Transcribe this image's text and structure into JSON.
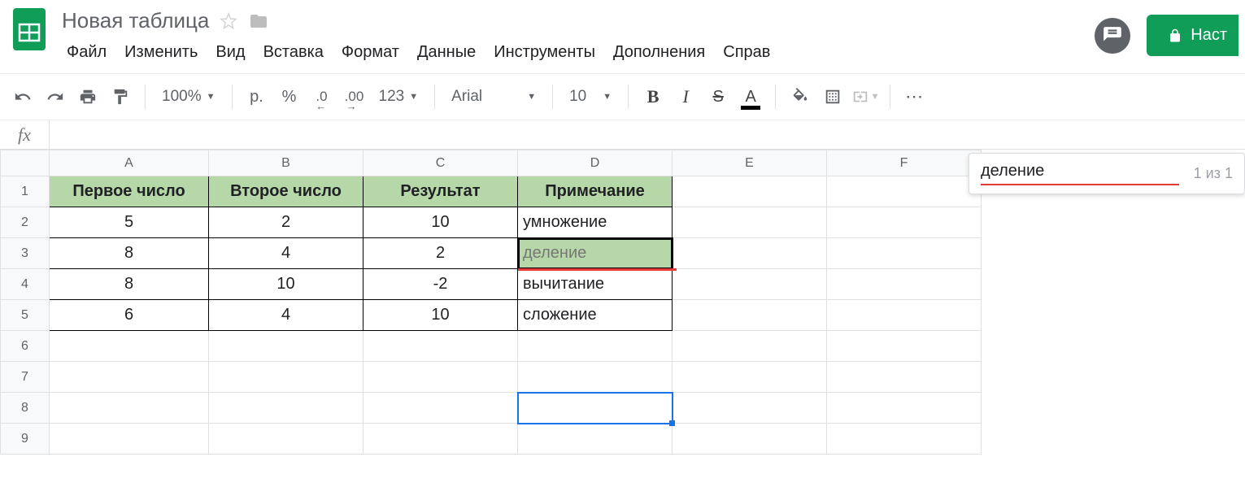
{
  "header": {
    "title": "Новая таблица",
    "menus": [
      "Файл",
      "Изменить",
      "Вид",
      "Вставка",
      "Формат",
      "Данные",
      "Инструменты",
      "Дополнения",
      "Справ"
    ],
    "share_label": "Наст"
  },
  "toolbar": {
    "zoom": "100%",
    "currency": "р.",
    "percent": "%",
    "dec_less": ".0",
    "dec_more": ".00",
    "format_more": "123",
    "font_name": "Arial",
    "font_size": "10",
    "bold": "B",
    "italic": "I",
    "strike": "S",
    "text_color": "A"
  },
  "formula_bar": {
    "fx": "fx",
    "value": ""
  },
  "grid": {
    "columns": [
      "A",
      "B",
      "C",
      "D",
      "E",
      "F"
    ],
    "row_numbers": [
      "1",
      "2",
      "3",
      "4",
      "5",
      "6",
      "7",
      "8",
      "9"
    ],
    "headers": [
      "Первое число",
      "Второе число",
      "Результат",
      "Примечание"
    ],
    "rows": [
      {
        "a": "5",
        "b": "2",
        "c": "10",
        "d": "умножение"
      },
      {
        "a": "8",
        "b": "4",
        "c": "2",
        "d": "деление"
      },
      {
        "a": "8",
        "b": "10",
        "c": "-2",
        "d": "вычитание"
      },
      {
        "a": "6",
        "b": "4",
        "c": "10",
        "d": "сложение"
      }
    ]
  },
  "find": {
    "query": "деление",
    "count": "1 из 1"
  }
}
